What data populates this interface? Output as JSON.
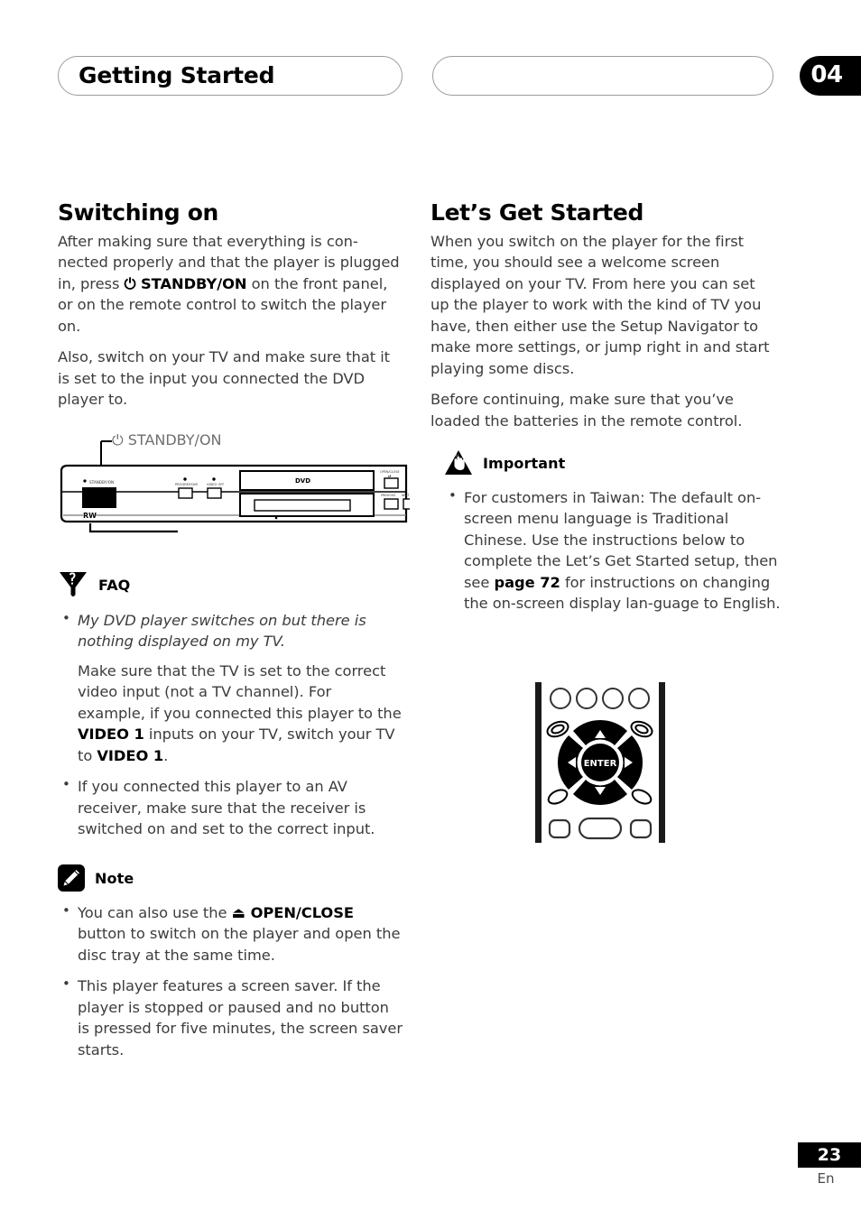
{
  "header": {
    "section_title": "Getting Started",
    "right_pill_text": "",
    "chapter_number": "04"
  },
  "left_column": {
    "title": "Switching on",
    "paragraphs": [
      {
        "parts": [
          {
            "text": "After making sure that everything is con-nected properly and that the player is plugged in, press ",
            "style": "normal"
          },
          {
            "text": "⏻ STANDBY/ON",
            "style": "bold"
          },
          {
            "text": " on the front panel, or on the remote control to switch the player on.",
            "style": "normal"
          }
        ]
      },
      {
        "parts": [
          {
            "text": "Also, switch on your TV and make sure that it is set to the input you connected the DVD player to.",
            "style": "normal"
          }
        ]
      }
    ],
    "figure": {
      "name": "dvd-player-front-panel",
      "callout_label": "STANDBY/ON",
      "callout_symbol": "⏻",
      "panel_labels": {
        "standby_on": "STANDBY/ON",
        "progressive": "PROGRESSIVE",
        "video_off": "VIDEO OFF",
        "open_close": "OPEN/CLOSE",
        "disc_logo": "DVD",
        "rw_logo": "RW"
      }
    },
    "faq": {
      "label": "FAQ",
      "icon": "faq-funnel-icon",
      "items": [
        {
          "question": "My DVD player switches on but there is nothing displayed on my TV.",
          "answer_parts": [
            {
              "text": "Make sure that the TV is set to the correct video input (not a TV channel). For example, if you connected this player to the ",
              "style": "normal"
            },
            {
              "text": "VIDEO 1",
              "style": "bold"
            },
            {
              "text": " inputs on your TV, switch your TV to ",
              "style": "normal"
            },
            {
              "text": "VIDEO 1",
              "style": "bold"
            },
            {
              "text": ".",
              "style": "normal"
            }
          ]
        },
        {
          "question": "",
          "answer_parts": [
            {
              "text": "If you connected this player to an AV receiver, make sure that the receiver is switched on and set to the correct input.",
              "style": "normal"
            }
          ]
        }
      ]
    },
    "note": {
      "label": "Note",
      "icon": "pencil-note-icon",
      "items": [
        {
          "parts": [
            {
              "text": "You can also use the ",
              "style": "normal"
            },
            {
              "text": "⏏ OPEN/CLOSE",
              "style": "bold"
            },
            {
              "text": " button to switch on the player and open the disc tray at the same time.",
              "style": "normal"
            }
          ]
        },
        {
          "parts": [
            {
              "text": "This player features a screen saver. If the player is stopped or paused and no button is pressed for five minutes, the screen saver starts.",
              "style": "normal"
            }
          ]
        }
      ]
    }
  },
  "right_column": {
    "title": "Let’s Get Started",
    "paragraphs": [
      {
        "parts": [
          {
            "text": "When you switch on the player for the first time, you should see a welcome screen displayed on your TV. From here you can set up the player to work with the kind of TV you have, then either use the Setup Navigator to make more settings, or jump right in and start playing some discs.",
            "style": "normal"
          }
        ]
      },
      {
        "parts": [
          {
            "text": "Before continuing, make sure that you’ve loaded the batteries in the remote control.",
            "style": "normal"
          }
        ]
      }
    ],
    "important": {
      "label": "Important",
      "icon": "warning-triangle-hand-icon",
      "items": [
        {
          "parts": [
            {
              "text": "For customers in Taiwan: The default on-screen menu language is Traditional Chinese. Use the instructions below to complete the Let’s Get Started setup, then see ",
              "style": "normal"
            },
            {
              "text": "page 72",
              "style": "bold"
            },
            {
              "text": " for instructions on changing the on-screen display lan-guage to English.",
              "style": "normal"
            }
          ]
        }
      ]
    },
    "figure": {
      "name": "remote-control-dpad",
      "enter_label": "ENTER",
      "top_buttons": 4,
      "bottom_buttons": 3,
      "arrows": [
        "up",
        "down",
        "left",
        "right"
      ]
    }
  },
  "footer": {
    "page_number": "23",
    "language_code": "En"
  },
  "colors": {
    "accent_black": "#000000",
    "body_text": "#3c3c3c",
    "pill_border": "#9b9b9b"
  }
}
